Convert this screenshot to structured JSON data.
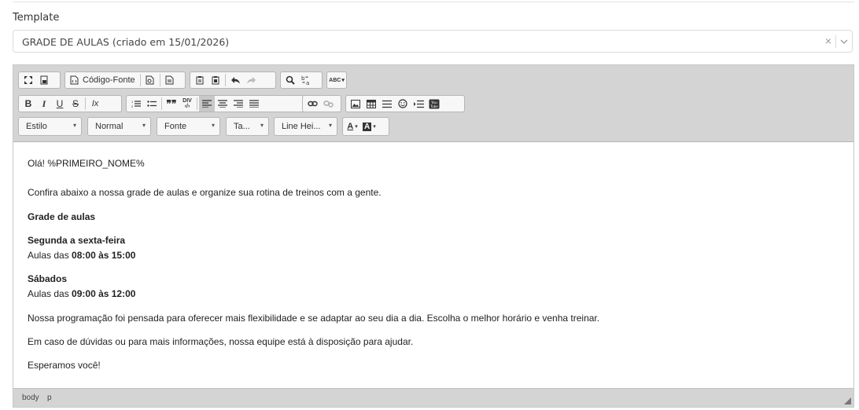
{
  "template": {
    "label": "Template",
    "selected": "GRADE DE AULAS (criado em 15/01/2026)",
    "clear_glyph": "×"
  },
  "toolbar": {
    "source_label": "Código-Fonte",
    "combos": {
      "style": "Estilo",
      "format": "Normal",
      "font": "Fonte",
      "size": "Ta...",
      "line_height": "Line Hei..."
    },
    "glyphs": {
      "bold": "B",
      "italic": "I",
      "underline": "U",
      "strike": "S",
      "remove_format": "Ix",
      "blockquote": "99",
      "div": "DIV",
      "text_color": "A",
      "bg_color": "A",
      "spell": "ABC",
      "youtube": "You"
    }
  },
  "body": {
    "greeting": "Olá!  %PRIMEIRO_NOME%",
    "intro": "Confira abaixo a nossa grade de aulas e organize sua rotina de treinos com a gente.",
    "heading": "Grade de aulas",
    "weekday_title": "Segunda a sexta-feira",
    "weekday_prefix": "Aulas das ",
    "weekday_hours": "08:00 às 15:00",
    "saturday_title": "Sábados",
    "saturday_prefix": "Aulas das ",
    "saturday_hours": "09:00 às 12:00",
    "program": "Nossa programação foi pensada para oferecer mais flexibilidade e se adaptar ao seu dia a dia. Escolha o melhor horário e venha treinar.",
    "doubts": "Em caso de dúvidas ou para mais informações, nossa equipe está à disposição para ajudar.",
    "closing": "Esperamos você!"
  },
  "statusbar": {
    "path": [
      "body",
      "p"
    ]
  }
}
